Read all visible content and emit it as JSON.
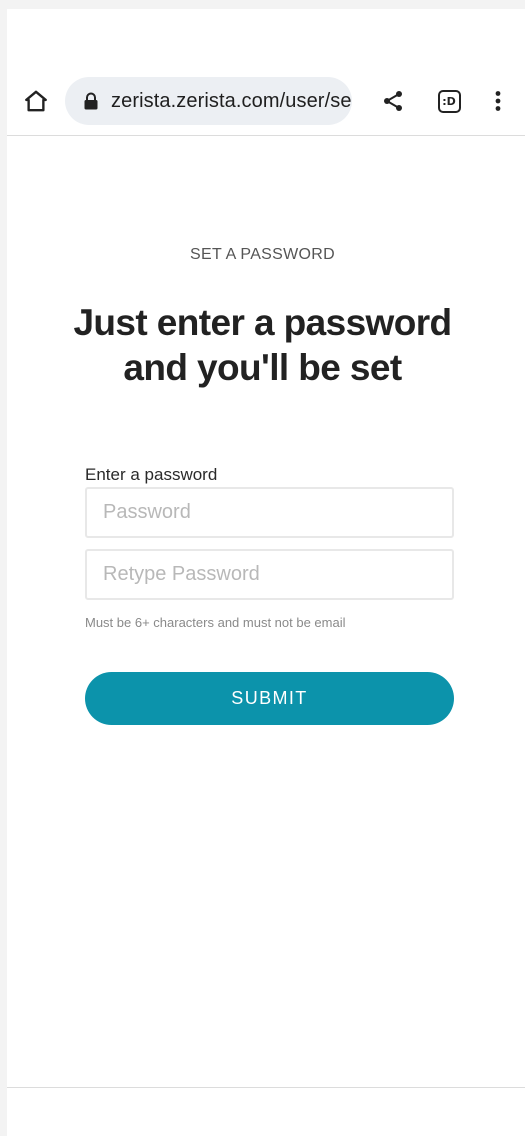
{
  "browser": {
    "url": "zerista.zerista.com/user/se",
    "tab_count": ":D",
    "icons": {
      "home": "home-icon",
      "lock": "lock-icon",
      "share": "share-icon",
      "tabs": "tab-switcher-icon",
      "menu": "more-vert-icon"
    }
  },
  "page": {
    "eyebrow": "SET A PASSWORD",
    "headline": "Just enter a password and you'll be set",
    "form": {
      "label": "Enter a password",
      "password_placeholder": "Password",
      "password_value": "",
      "retype_placeholder": "Retype Password",
      "retype_value": "",
      "hint": "Must be 6+ characters and must not be email",
      "submit_label": "SUBMIT"
    }
  },
  "colors": {
    "accent": "#0c93ab",
    "address_bar_bg": "#eceff3",
    "text_primary": "#222222",
    "text_muted": "#8a8a8a"
  }
}
